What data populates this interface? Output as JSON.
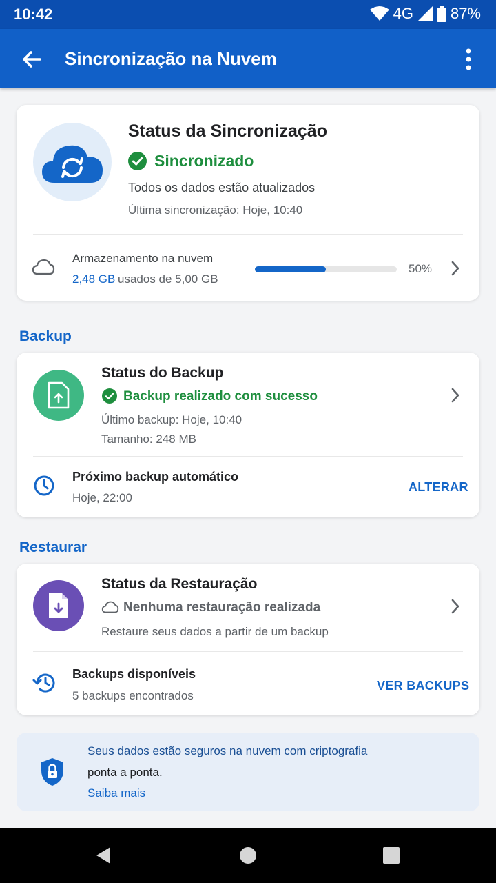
{
  "status_bar": {
    "time": "10:42",
    "network": "4G",
    "battery": "87%"
  },
  "app_bar": {
    "title": "Sincronização na Nuvem",
    "back_icon": "arrow-left-icon",
    "menu_icon": "more-vert-icon"
  },
  "sync_card": {
    "title": "Status da Sincronização",
    "status": "Sincronizado",
    "description": "Todos os dados estão atualizados",
    "last_sync": "Última sincronização: Hoje, 10:40",
    "storage_label": "Armazenamento na nuvem",
    "storage_used": "2,48 GB",
    "storage_total": "usados de 5,00 GB",
    "storage_percent_text": "50%",
    "storage_fraction": 0.5
  },
  "backup_section": {
    "label": "Backup",
    "title": "Status do Backup",
    "status": "Backup realizado com sucesso",
    "last_backup": "Último backup: Hoje, 10:40",
    "size": "Tamanho: 248 MB",
    "next_title": "Próximo backup automático",
    "next_time": "Hoje, 22:00",
    "action": "ALTERAR"
  },
  "restore_section": {
    "label": "Restaurar",
    "title": "Status da Restauração",
    "status": "Nenhuma restauração realizada",
    "description": "Restaure seus dados a partir de um backup",
    "available_title": "Backups disponíveis",
    "available_count": "5 backups encontrados",
    "action": "VER BACKUPS"
  },
  "info_banner": {
    "line1": "Seus dados estão seguros na nuvem com criptografia",
    "line2": "ponta a ponta.",
    "link": "Saiba mais"
  },
  "colors": {
    "primary": "#1466c8",
    "success": "#1e8e3e",
    "backup_circle": "#3fb884",
    "restore_circle": "#6a4fb5"
  }
}
